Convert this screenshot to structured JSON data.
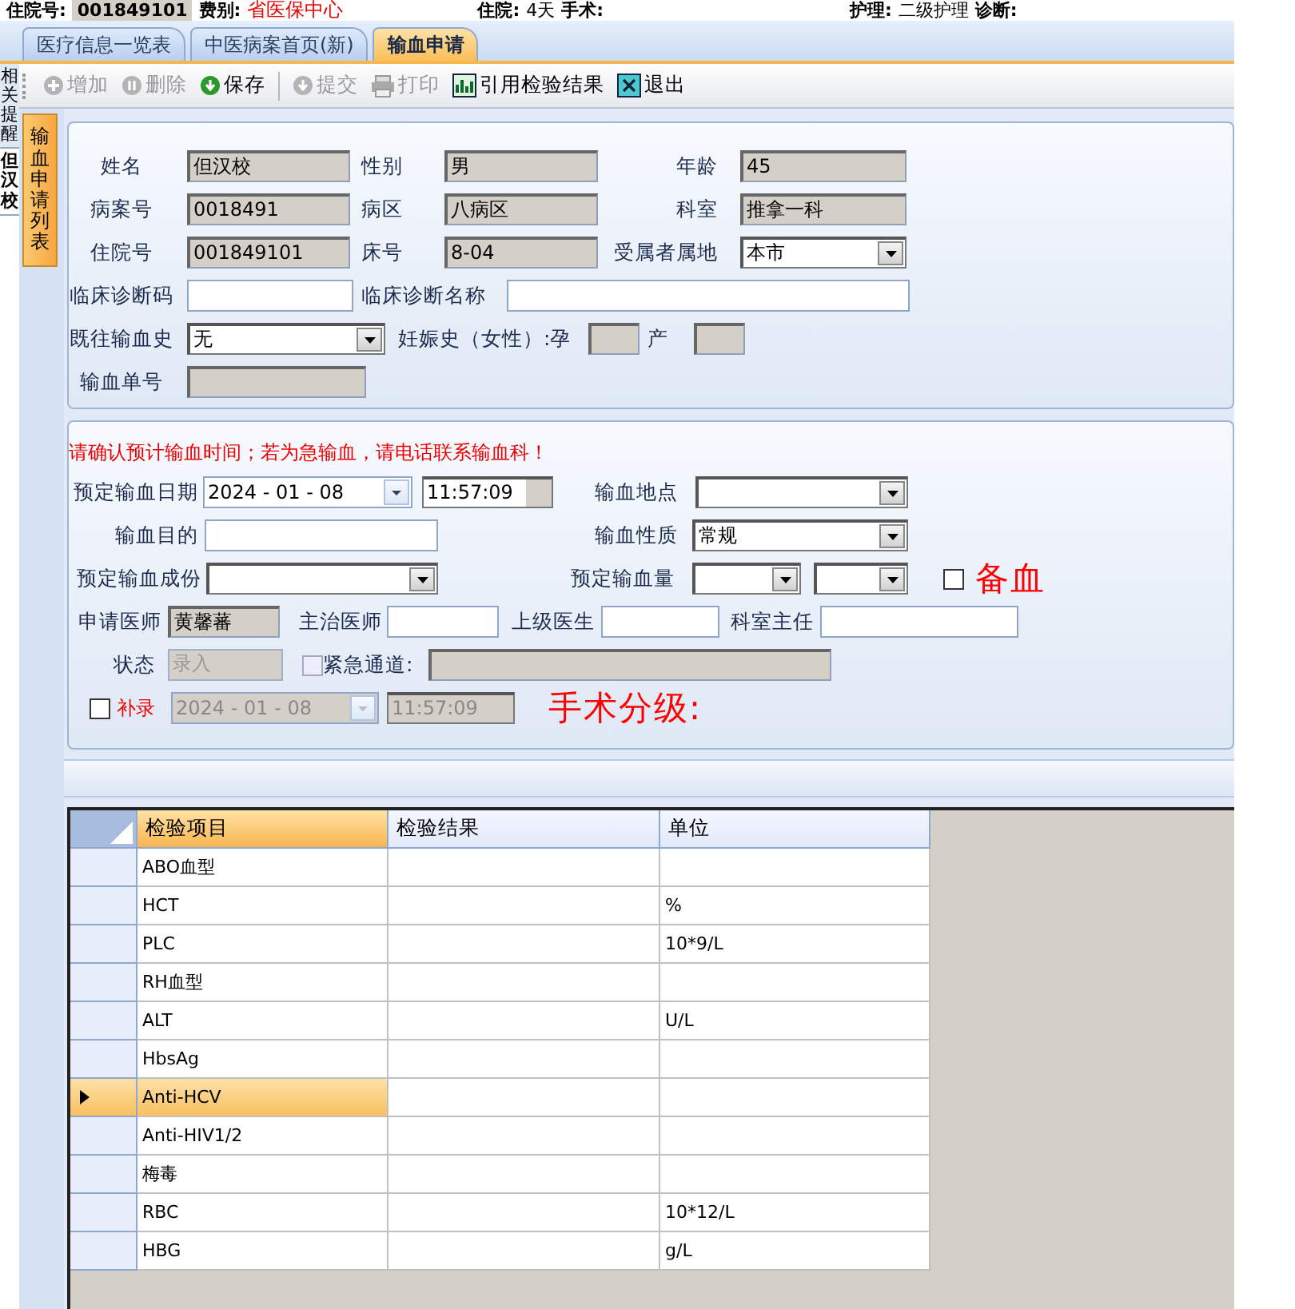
{
  "header_strip": [
    {
      "label": "住院号:",
      "value": "001849101",
      "kind": "boxed"
    },
    {
      "label": "费别:",
      "value": "省医保中心",
      "kind": "alert"
    },
    {
      "label": "住院:",
      "value": "4天",
      "kind": "plain"
    },
    {
      "label": "手术:",
      "kind": "plain"
    },
    {
      "label": "护理:",
      "value": "二级护理",
      "kind": "plain"
    },
    {
      "label": "诊断:",
      "kind": "plain"
    }
  ],
  "tabs": [
    {
      "label": "医疗信息一览表",
      "selected": false
    },
    {
      "label": "中医病案首页(新)",
      "selected": false
    },
    {
      "label": "输血申请",
      "selected": true
    }
  ],
  "toolbar": [
    {
      "label": "增加",
      "disabled": true
    },
    {
      "label": "删除",
      "disabled": true
    },
    {
      "label": "保存",
      "disabled": false
    },
    {
      "label": "提交",
      "disabled": true
    },
    {
      "label": "打印",
      "disabled": true
    },
    {
      "label": "引用检验结果",
      "disabled": false
    },
    {
      "label": "退出",
      "disabled": false
    }
  ],
  "side_tabs": [
    {
      "label": "相关提醒",
      "selected": false
    },
    {
      "label": "但汉校",
      "selected": true
    }
  ],
  "list_tab": {
    "label": "输血申请列表",
    "selected": true
  },
  "patient_panel": [
    [
      {
        "kind": "label",
        "text": "姓名"
      },
      {
        "kind": "readonly",
        "value": "但汉校"
      },
      {
        "kind": "label",
        "text": "性别"
      },
      {
        "kind": "readonly",
        "value": "男"
      },
      {
        "kind": "label",
        "text": "年龄"
      },
      {
        "kind": "readonly",
        "value": "45"
      }
    ],
    [
      {
        "kind": "label",
        "text": "病案号"
      },
      {
        "kind": "readonly",
        "value": "0018491"
      },
      {
        "kind": "label",
        "text": "病区"
      },
      {
        "kind": "readonly",
        "value": "八病区"
      },
      {
        "kind": "label",
        "text": "科室"
      },
      {
        "kind": "readonly",
        "value": "推拿一科"
      }
    ],
    [
      {
        "kind": "label",
        "text": "住院号"
      },
      {
        "kind": "readonly",
        "value": "001849101"
      },
      {
        "kind": "label",
        "text": "床号"
      },
      {
        "kind": "readonly",
        "value": "8-04"
      },
      {
        "kind": "label",
        "text": "受属者属地"
      },
      {
        "kind": "select",
        "value": "本市"
      }
    ],
    [
      {
        "kind": "label",
        "text": "临床诊断码"
      },
      {
        "kind": "input"
      },
      {
        "kind": "label",
        "text": "临床诊断名称"
      },
      {
        "kind": "input"
      }
    ],
    [
      {
        "kind": "label",
        "text": "既往输血史"
      },
      {
        "kind": "select",
        "value": "无"
      },
      {
        "kind": "label",
        "text": "妊娠史（女性）:孕"
      },
      {
        "kind": "readonly"
      },
      {
        "kind": "label",
        "text": "产"
      },
      {
        "kind": "readonly"
      }
    ],
    [
      {
        "kind": "label",
        "text": "输血单号"
      },
      {
        "kind": "readonly"
      }
    ]
  ],
  "request_panel": [
    [
      {
        "kind": "alert",
        "text": "请确认预计输血时间；若为急输血，请电话联系输血科！"
      }
    ],
    [
      {
        "kind": "label",
        "text": "预定输血日期"
      },
      {
        "kind": "date",
        "value": "2024 - 01 - 08",
        "disabled": false
      },
      {
        "kind": "time",
        "value": "11:57:09",
        "disabled": false
      },
      {
        "kind": "label",
        "text": "输血地点"
      },
      {
        "kind": "select"
      }
    ],
    [
      {
        "kind": "label",
        "text": "输血目的"
      },
      {
        "kind": "input"
      },
      {
        "kind": "label",
        "text": "输血性质"
      },
      {
        "kind": "select",
        "value": "常规"
      }
    ],
    [
      {
        "kind": "label",
        "text": "预定输血成份"
      },
      {
        "kind": "select"
      },
      {
        "kind": "label",
        "text": "预定输血量"
      },
      {
        "kind": "select"
      },
      {
        "kind": "select"
      },
      {
        "kind": "checkbox",
        "checked": false,
        "disabled": false
      },
      {
        "kind": "banner",
        "text": "备血"
      }
    ],
    [
      {
        "kind": "label",
        "text": "申请医师"
      },
      {
        "kind": "readonly",
        "value": "黄馨蕃"
      },
      {
        "kind": "label",
        "text": "主治医师"
      },
      {
        "kind": "input"
      },
      {
        "kind": "label",
        "text": "上级医生"
      },
      {
        "kind": "input"
      },
      {
        "kind": "label",
        "text": "科室主任"
      },
      {
        "kind": "input"
      }
    ],
    [
      {
        "kind": "label",
        "text": "状态"
      },
      {
        "kind": "status",
        "value": "录入"
      },
      {
        "kind": "checkbox",
        "checked": false,
        "disabled": true
      },
      {
        "kind": "label",
        "text": "紧急通道:"
      },
      {
        "kind": "readonly"
      }
    ],
    [
      {
        "kind": "checkbox",
        "checked": false,
        "disabled": false
      },
      {
        "kind": "alert",
        "text": "补录"
      },
      {
        "kind": "date",
        "value": "2024 - 01 - 08",
        "disabled": true
      },
      {
        "kind": "time",
        "value": "11:57:09",
        "disabled": true
      },
      {
        "kind": "banner",
        "text": "手术分级:"
      }
    ]
  ],
  "table": {
    "columns": [
      {
        "label": "检验项目",
        "selected": true
      },
      {
        "label": "检验结果",
        "selected": false
      },
      {
        "label": "单位",
        "selected": false
      }
    ],
    "rows": [
      {
        "item": "ABO血型",
        "selected": false
      },
      {
        "item": "HCT",
        "unit": "%",
        "selected": false
      },
      {
        "item": "PLC",
        "unit": "10*9/L",
        "selected": false
      },
      {
        "item": "RH血型",
        "selected": false
      },
      {
        "item": "ALT",
        "unit": "U/L",
        "selected": false
      },
      {
        "item": "HbsAg",
        "selected": false
      },
      {
        "item": "Anti-HCV",
        "selected": true
      },
      {
        "item": "Anti-HIV1/2",
        "selected": false
      },
      {
        "item": "梅毒",
        "selected": false
      },
      {
        "item": "RBC",
        "unit": "10*12/L",
        "selected": false
      },
      {
        "item": "HBG",
        "unit": "g/L",
        "selected": false
      }
    ]
  }
}
